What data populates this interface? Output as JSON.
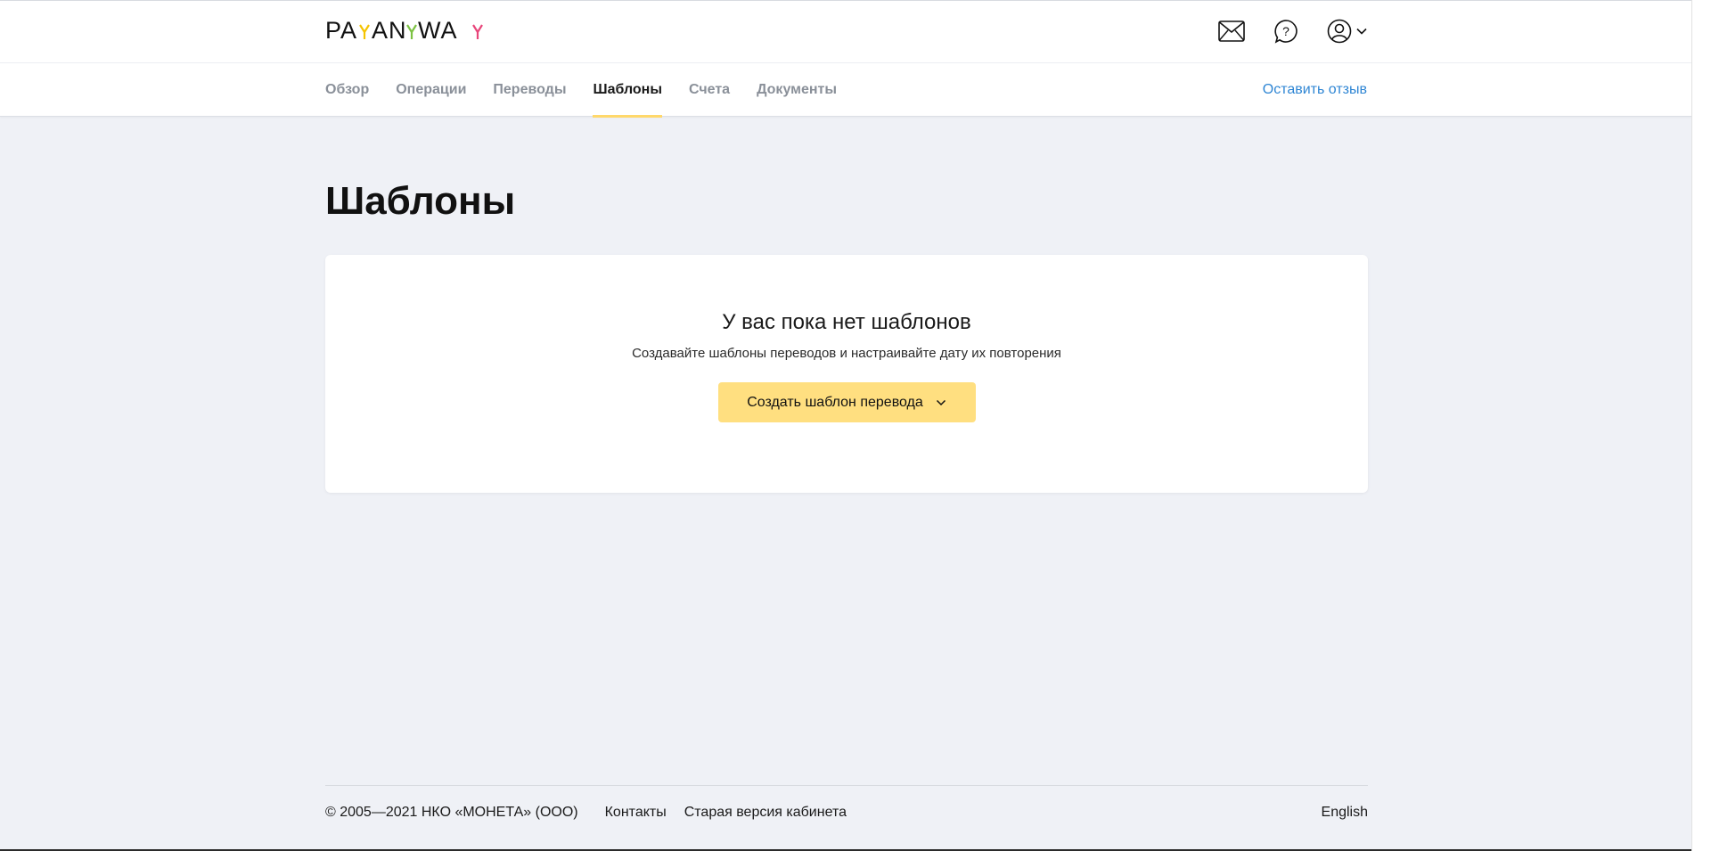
{
  "header": {
    "logo_text": "PAYANYWAY",
    "logo_colors": {
      "a_accent": "#f5c400",
      "y_accent": "#7cc242",
      "y2_accent": "#e8457a"
    },
    "icons": [
      "mail-icon",
      "help-icon",
      "user-icon",
      "chevron-down-icon"
    ]
  },
  "nav": {
    "tabs": [
      {
        "label": "Обзор",
        "active": false
      },
      {
        "label": "Операции",
        "active": false
      },
      {
        "label": "Переводы",
        "active": false
      },
      {
        "label": "Шаблоны",
        "active": true
      },
      {
        "label": "Счета",
        "active": false
      },
      {
        "label": "Документы",
        "active": false
      }
    ],
    "feedback_link": "Оставить отзыв"
  },
  "main": {
    "page_title": "Шаблоны",
    "empty_state": {
      "title": "У вас пока нет шаблонов",
      "subtitle": "Создавайте шаблоны переводов и настраивайте дату их повторения",
      "button_label": "Создать шаблон перевода"
    }
  },
  "footer": {
    "copyright": "© 2005—2021 НКО «МОНЕТА» (ООО)",
    "links": [
      "Контакты",
      "Старая версия кабинета"
    ],
    "language": "English"
  },
  "colors": {
    "accent_yellow": "#ffdf80",
    "tab_underline": "#ffd86b",
    "link_blue": "#2f86d4",
    "page_bg": "#eff1f6"
  }
}
